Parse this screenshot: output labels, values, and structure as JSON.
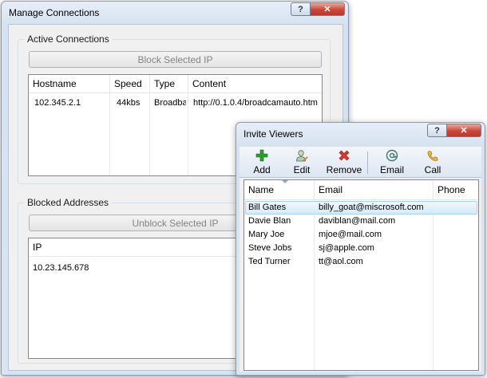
{
  "manage": {
    "title": "Manage Connections",
    "help_glyph": "?",
    "close_glyph": "✕",
    "active": {
      "label": "Active Connections",
      "block_button": "Block Selected IP",
      "columns": [
        "Hostname",
        "Speed",
        "Type",
        "Content"
      ],
      "rows": [
        {
          "hostname": "102.345.2.1",
          "speed": "44kbs",
          "type": "Broadba",
          "content": "http://0.1.0.4/broadcamauto.htm"
        }
      ]
    },
    "blocked": {
      "label": "Blocked Addresses",
      "unblock_button": "Unblock Selected IP",
      "column": "IP",
      "rows": [
        "10.23.145.678"
      ]
    }
  },
  "invite": {
    "title": "Invite Viewers",
    "help_glyph": "?",
    "close_glyph": "✕",
    "toolbar": {
      "add": "Add",
      "edit": "Edit",
      "remove": "Remove",
      "email": "Email",
      "call": "Call"
    },
    "icons": {
      "add": "plus-icon",
      "edit": "user-edit-icon",
      "remove": "x-icon",
      "email": "at-icon",
      "call": "phone-icon"
    },
    "columns": [
      "Name",
      "Email",
      "Phone"
    ],
    "rows": [
      {
        "name": "Bill Gates",
        "email": "billy_goat@miscrosoft.com",
        "phone": ""
      },
      {
        "name": "Davie Blan",
        "email": "daviblan@mail.com",
        "phone": ""
      },
      {
        "name": "Mary Joe",
        "email": "mjoe@mail.com",
        "phone": ""
      },
      {
        "name": "Steve Jobs",
        "email": "sj@apple.com",
        "phone": ""
      },
      {
        "name": "Ted Turner",
        "email": "tt@aol.com",
        "phone": ""
      }
    ],
    "selected_index": 0
  },
  "colors": {
    "close": "#c9473a",
    "selection": "#d5eaf9",
    "add_green": "#2e9b2e",
    "remove_red": "#d8372a"
  }
}
